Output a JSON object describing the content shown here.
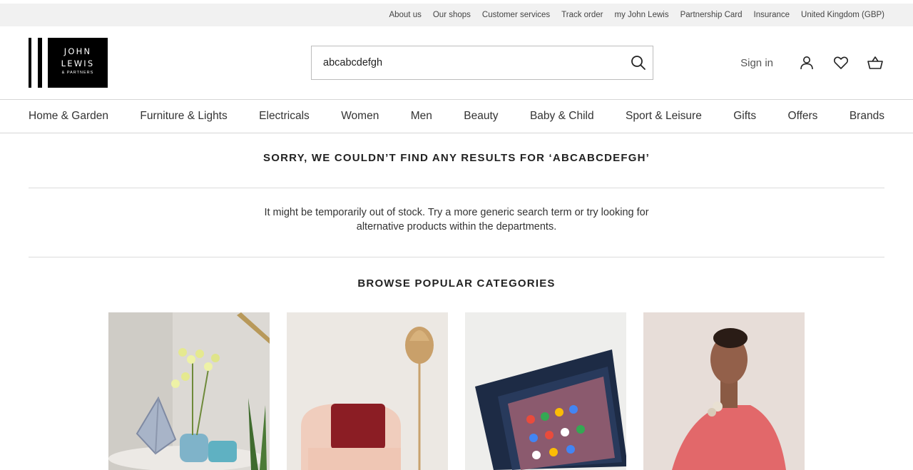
{
  "top_links": [
    "About us",
    "Our shops",
    "Customer services",
    "Track order",
    "my John Lewis",
    "Partnership Card",
    "Insurance",
    "United Kingdom (GBP)"
  ],
  "logo": {
    "line1": "JOHN",
    "line2": "LEWIS",
    "line3": "& PARTNERS"
  },
  "search": {
    "value": "abcabcdefgh",
    "icon": "search-icon"
  },
  "account": {
    "sign_in": "Sign in",
    "icons": [
      "user-icon",
      "heart-icon",
      "basket-icon"
    ]
  },
  "nav": [
    "Home & Garden",
    "Furniture & Lights",
    "Electricals",
    "Women",
    "Men",
    "Beauty",
    "Baby & Child",
    "Sport & Leisure",
    "Gifts",
    "Offers",
    "Brands"
  ],
  "results": {
    "heading": "SORRY, WE COULDN’T FIND ANY RESULTS FOR ‘ABCABCDEFGH’",
    "help_line1": "It might be temporarily out of stock. Try a more generic search term or try looking for",
    "help_line2": "alternative products within the departments."
  },
  "browse": {
    "heading": "BROWSE POPULAR CATEGORIES"
  },
  "colors": {
    "topbar_bg": "#f1f1f1",
    "logo": "#000000",
    "divider": "#d6d6d6"
  }
}
